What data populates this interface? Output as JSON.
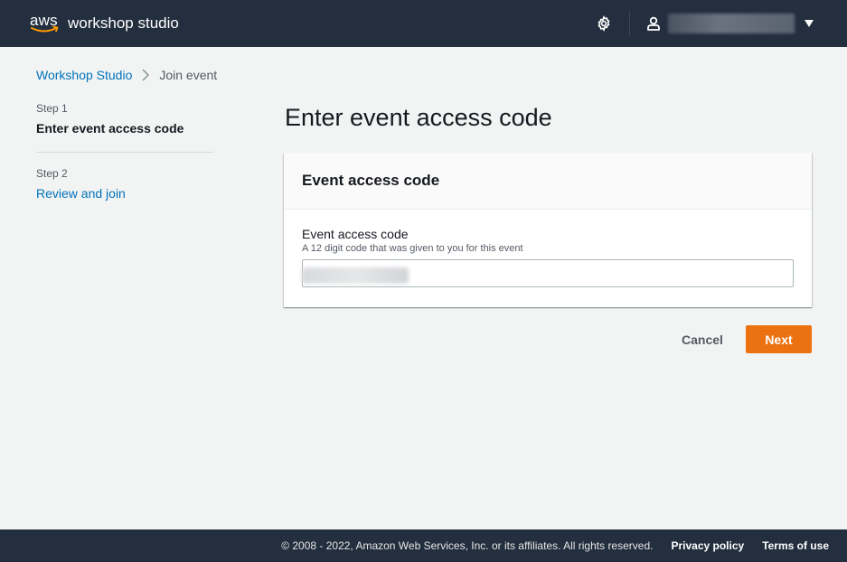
{
  "header": {
    "logo_text": "aws",
    "brand_name": "workshop studio",
    "icons": {
      "settings": "gear-icon",
      "user": "user-icon",
      "menu": "caret-down-icon"
    }
  },
  "breadcrumb": {
    "root": "Workshop Studio",
    "current": "Join event"
  },
  "steps": [
    {
      "number": "Step 1",
      "title": "Enter event access code",
      "state": "active"
    },
    {
      "number": "Step 2",
      "title": "Review and join",
      "state": "link"
    }
  ],
  "main": {
    "title": "Enter event access code",
    "panel": {
      "header": "Event access code",
      "field": {
        "label": "Event access code",
        "description": "A 12 digit code that was given to you for this event",
        "value": ""
      }
    }
  },
  "actions": {
    "cancel_label": "Cancel",
    "next_label": "Next"
  },
  "footer": {
    "copyright": "© 2008 - 2022, Amazon Web Services, Inc. or its affiliates. All rights reserved.",
    "privacy": "Privacy policy",
    "terms": "Terms of use"
  },
  "colors": {
    "header_bg": "#232f3e",
    "link": "#0073bb",
    "primary": "#ec7211",
    "page_bg": "#f2f3f3"
  }
}
